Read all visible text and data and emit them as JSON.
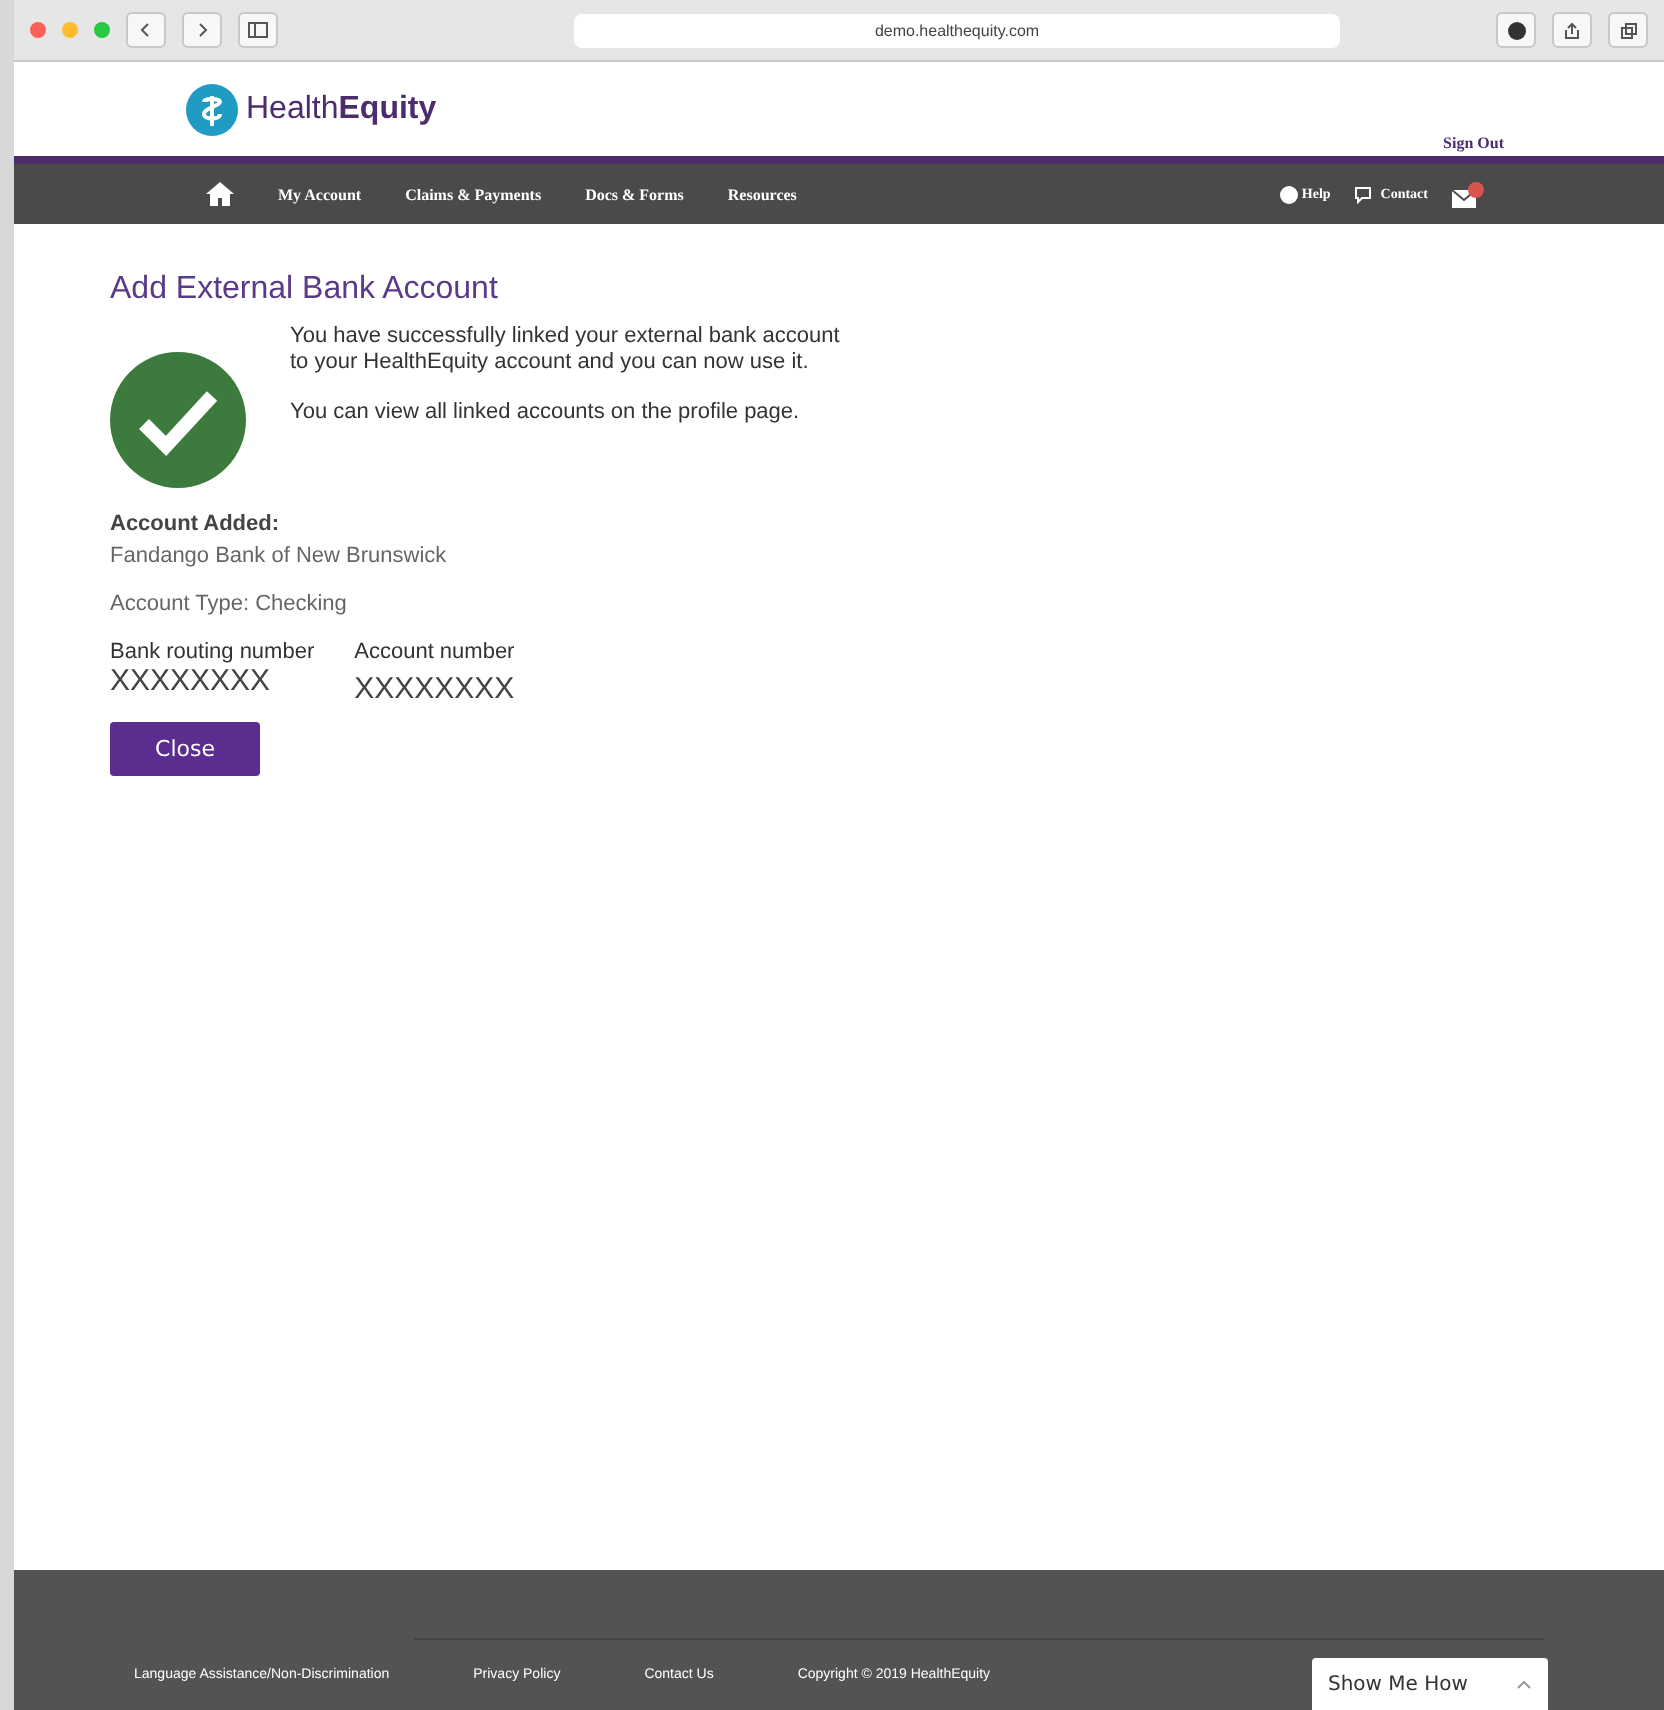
{
  "browser": {
    "url": "demo.healthequity.com"
  },
  "header": {
    "logo": "Health**Equity**",
    "sign_out": "Sign Out"
  },
  "nav": {
    "items": [
      "My Account",
      "Claims & Payments",
      "Docs & Forms",
      "Resources"
    ],
    "help": "Help",
    "contact": "Contact"
  },
  "page": {
    "title": "Add External Bank Account",
    "messages": [
      "You have successfully linked your external bank account to your HealthEquity account and you can now use it.",
      "You can view all linked accounts on the profile page."
    ],
    "account_added_label": "Account Added:",
    "bank_name": "Fandango Bank of New Brunswick",
    "account_type": "Account Type: Checking",
    "fields": [
      {
        "label": "Bank routing number",
        "value": "XXXXXXXX"
      },
      {
        "label": "Account number",
        "value": "XXXXXXXX"
      }
    ],
    "close_button": "Close"
  },
  "footer": {
    "links": [
      "Language Assistance/Non-Discrimination",
      "Privacy Policy",
      "Contact Us"
    ],
    "copyright": "Copyright © 2019 HealthEquity",
    "show_me_how": "Show Me How"
  }
}
